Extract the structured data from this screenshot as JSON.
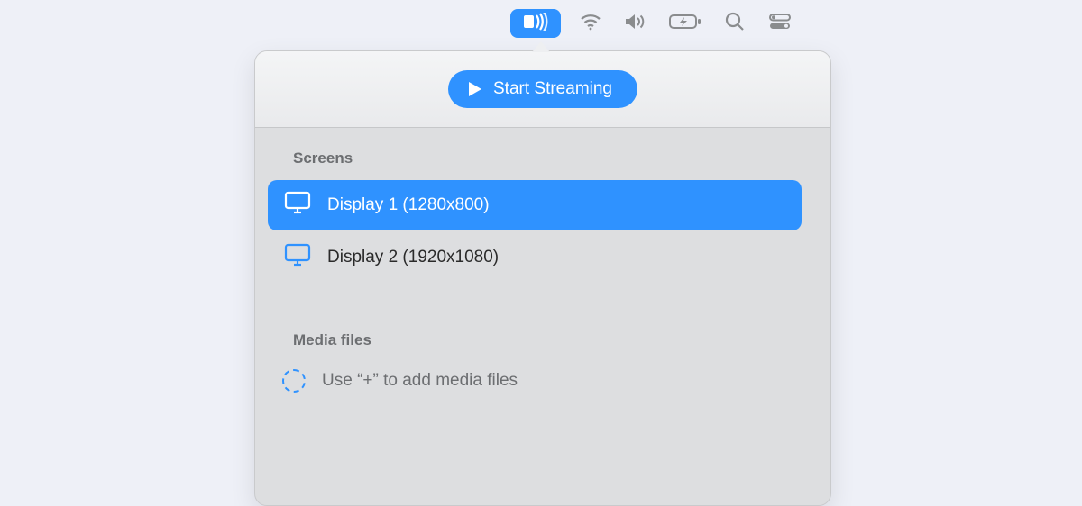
{
  "menubar": {
    "cast_icon": "cast-icon",
    "wifi_icon": "wifi-icon",
    "volume_icon": "volume-icon",
    "battery_icon": "battery-charging-icon",
    "search_icon": "search-icon",
    "control_center_icon": "control-center-icon"
  },
  "panel": {
    "start_label": "Start Streaming",
    "screens_title": "Screens",
    "screens": [
      {
        "label": "Display 1 (1280x800)",
        "selected": true
      },
      {
        "label": "Display 2 (1920x1080)",
        "selected": false
      }
    ],
    "media_title": "Media files",
    "media_placeholder": "Use “+” to add media files"
  }
}
